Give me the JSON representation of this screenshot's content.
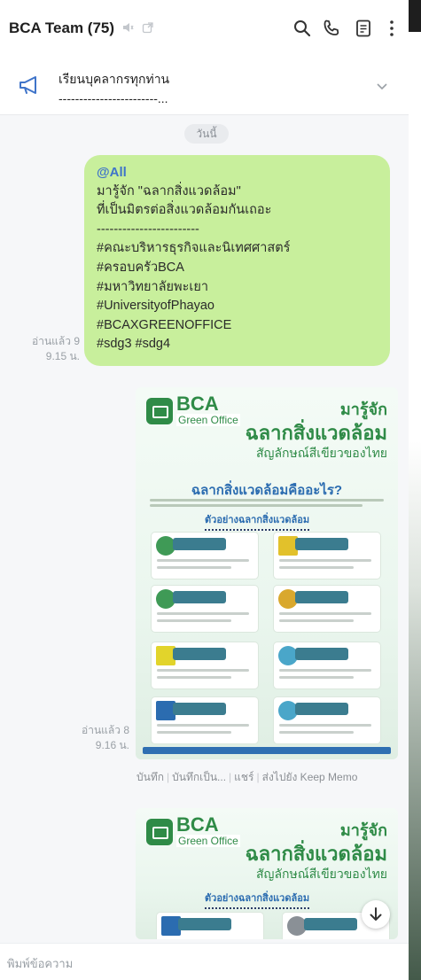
{
  "header": {
    "title": "BCA Team (75)",
    "icons": [
      "mute-icon",
      "external-icon",
      "search-icon",
      "phone-icon",
      "notes-icon",
      "more-icon"
    ]
  },
  "announcement": {
    "line1": "เรียนบุคลากรทุกท่าน",
    "line2": "------------------------..."
  },
  "date_separator": "วันนี้",
  "message": {
    "mention": "@All",
    "lines": [
      "มารู้จัก \"ฉลากสิ่งแวดล้อม\"",
      "ที่เป็นมิตรต่อสิ่งแวดล้อมกันเถอะ",
      "------------------------",
      "#คณะบริหารธุรกิจและนิเทศศาสตร์",
      "#ครอบครัวBCA",
      "#มหาวิทยาลัยพะเยา",
      "#UniversityofPhayao",
      "#BCAXGREENOFFICE",
      "#sdg3 #sdg4"
    ],
    "read_status": "อ่านแล้ว 9",
    "time": "9.15 น."
  },
  "image_message_1": {
    "read_status": "อ่านแล้ว 8",
    "time": "9.16 น."
  },
  "poster": {
    "brand": "BCA",
    "brand_sub": "Green Office",
    "headline_1": "มารู้จัก",
    "headline_2": "ฉลากสิ่งแวดล้อม",
    "headline_3": "สัญลักษณ์สีเขียวของไทย",
    "question": "ฉลากสิ่งแวดล้อมคืออะไร?",
    "examples_heading": "ตัวอย่างฉลากสิ่งแวดล้อม"
  },
  "actions": [
    "บันทึก",
    "บันทึกเป็น...",
    "แชร์",
    "ส่งไปยัง Keep Memo"
  ],
  "composer": {
    "placeholder": "พิมพ์ข้อความ"
  },
  "colors": {
    "bubble": "#c8ef9c",
    "mention": "#3f74c9",
    "poster_green": "#2f8b47",
    "poster_blue": "#2b6cb0"
  }
}
